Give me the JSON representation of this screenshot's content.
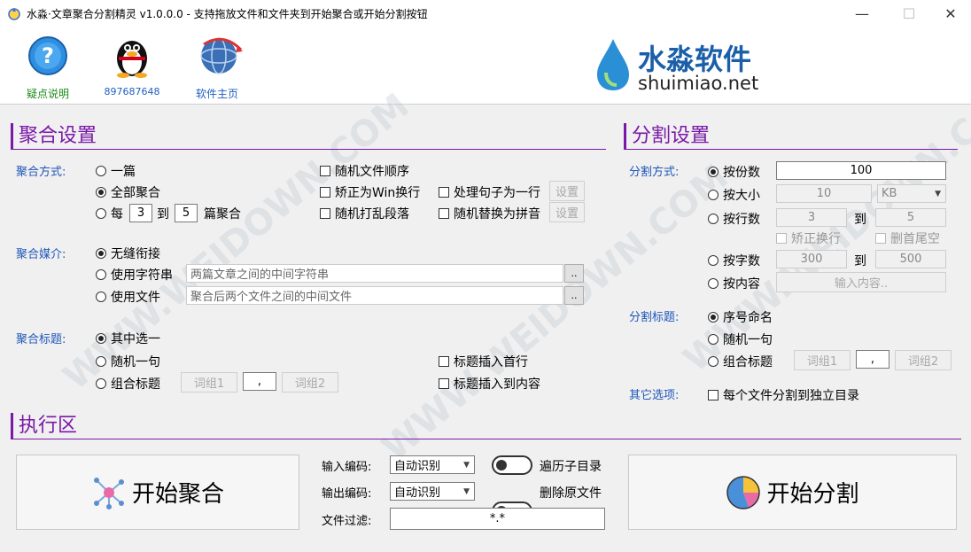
{
  "window": {
    "title": "水淼·文章聚合分割精灵 v1.0.0.0 - 支持拖放文件和文件夹到开始聚合或开始分割按钮",
    "minimize": "—",
    "maximize": "☐",
    "close": "✕"
  },
  "toolbar": {
    "help": "疑点说明",
    "qq": "897687648",
    "home": "软件主页"
  },
  "brand": {
    "cn": "水淼软件",
    "url": "shuimiao.net"
  },
  "aggregate": {
    "title": "聚合设置",
    "mode_label": "聚合方式:",
    "mode_one": "一篇",
    "mode_all": "全部聚合",
    "mode_every": "每",
    "every_from": "3",
    "to": "到",
    "every_to": "5",
    "every_suffix": "篇聚合",
    "random_order": "随机文件顺序",
    "fix_win": "矫正为Win换行",
    "shuffle_paragraph": "随机打乱段落",
    "sentence_one_line": "处理句子为一行",
    "random_pinyin": "随机替换为拼音",
    "set": "设置",
    "medium_label": "聚合媒介:",
    "seamless": "无缝衔接",
    "use_string": "使用字符串",
    "string_placeholder": "两篇文章之间的中间字符串",
    "use_file": "使用文件",
    "file_placeholder": "聚合后两个文件之间的中间文件",
    "browse": "..",
    "title_label": "聚合标题:",
    "title_one_of": "其中选一",
    "title_random": "随机一句",
    "title_combine": "组合标题",
    "group1": "词组1",
    "sep": ",",
    "group2": "词组2",
    "insert_first": "标题插入首行",
    "insert_content": "标题插入到内容"
  },
  "split": {
    "title": "分割设置",
    "mode_label": "分割方式:",
    "by_count": "按份数",
    "count_value": "100",
    "by_size": "按大小",
    "size_value": "10",
    "size_unit": "KB",
    "by_lines": "按行数",
    "lines_from": "3",
    "to": "到",
    "lines_to": "5",
    "fix_newline": "矫正换行",
    "trim_tail": "删首尾空",
    "by_chars": "按字数",
    "chars_from": "300",
    "chars_to": "500",
    "by_content": "按内容",
    "content_btn": "输入内容..",
    "title_label": "分割标题:",
    "seq_name": "序号命名",
    "random_one": "随机一句",
    "combine": "组合标题",
    "group1": "词组1",
    "sep": ",",
    "group2": "词组2",
    "other_label": "其它选项:",
    "separate_dir": "每个文件分割到独立目录"
  },
  "exec": {
    "title": "执行区",
    "start_aggregate": "开始聚合",
    "input_enc_label": "输入编码:",
    "input_enc": "自动识别",
    "output_enc_label": "输出编码:",
    "output_enc": "自动识别",
    "traverse": "遍历子目录",
    "delete_src": "删除原文件",
    "filter_label": "文件过滤:",
    "filter_value": "*.*",
    "start_split": "开始分割"
  },
  "colors": {
    "accent": "#7a18a8",
    "label_blue": "#1f56b8",
    "link_green": "#1a8a1a"
  }
}
